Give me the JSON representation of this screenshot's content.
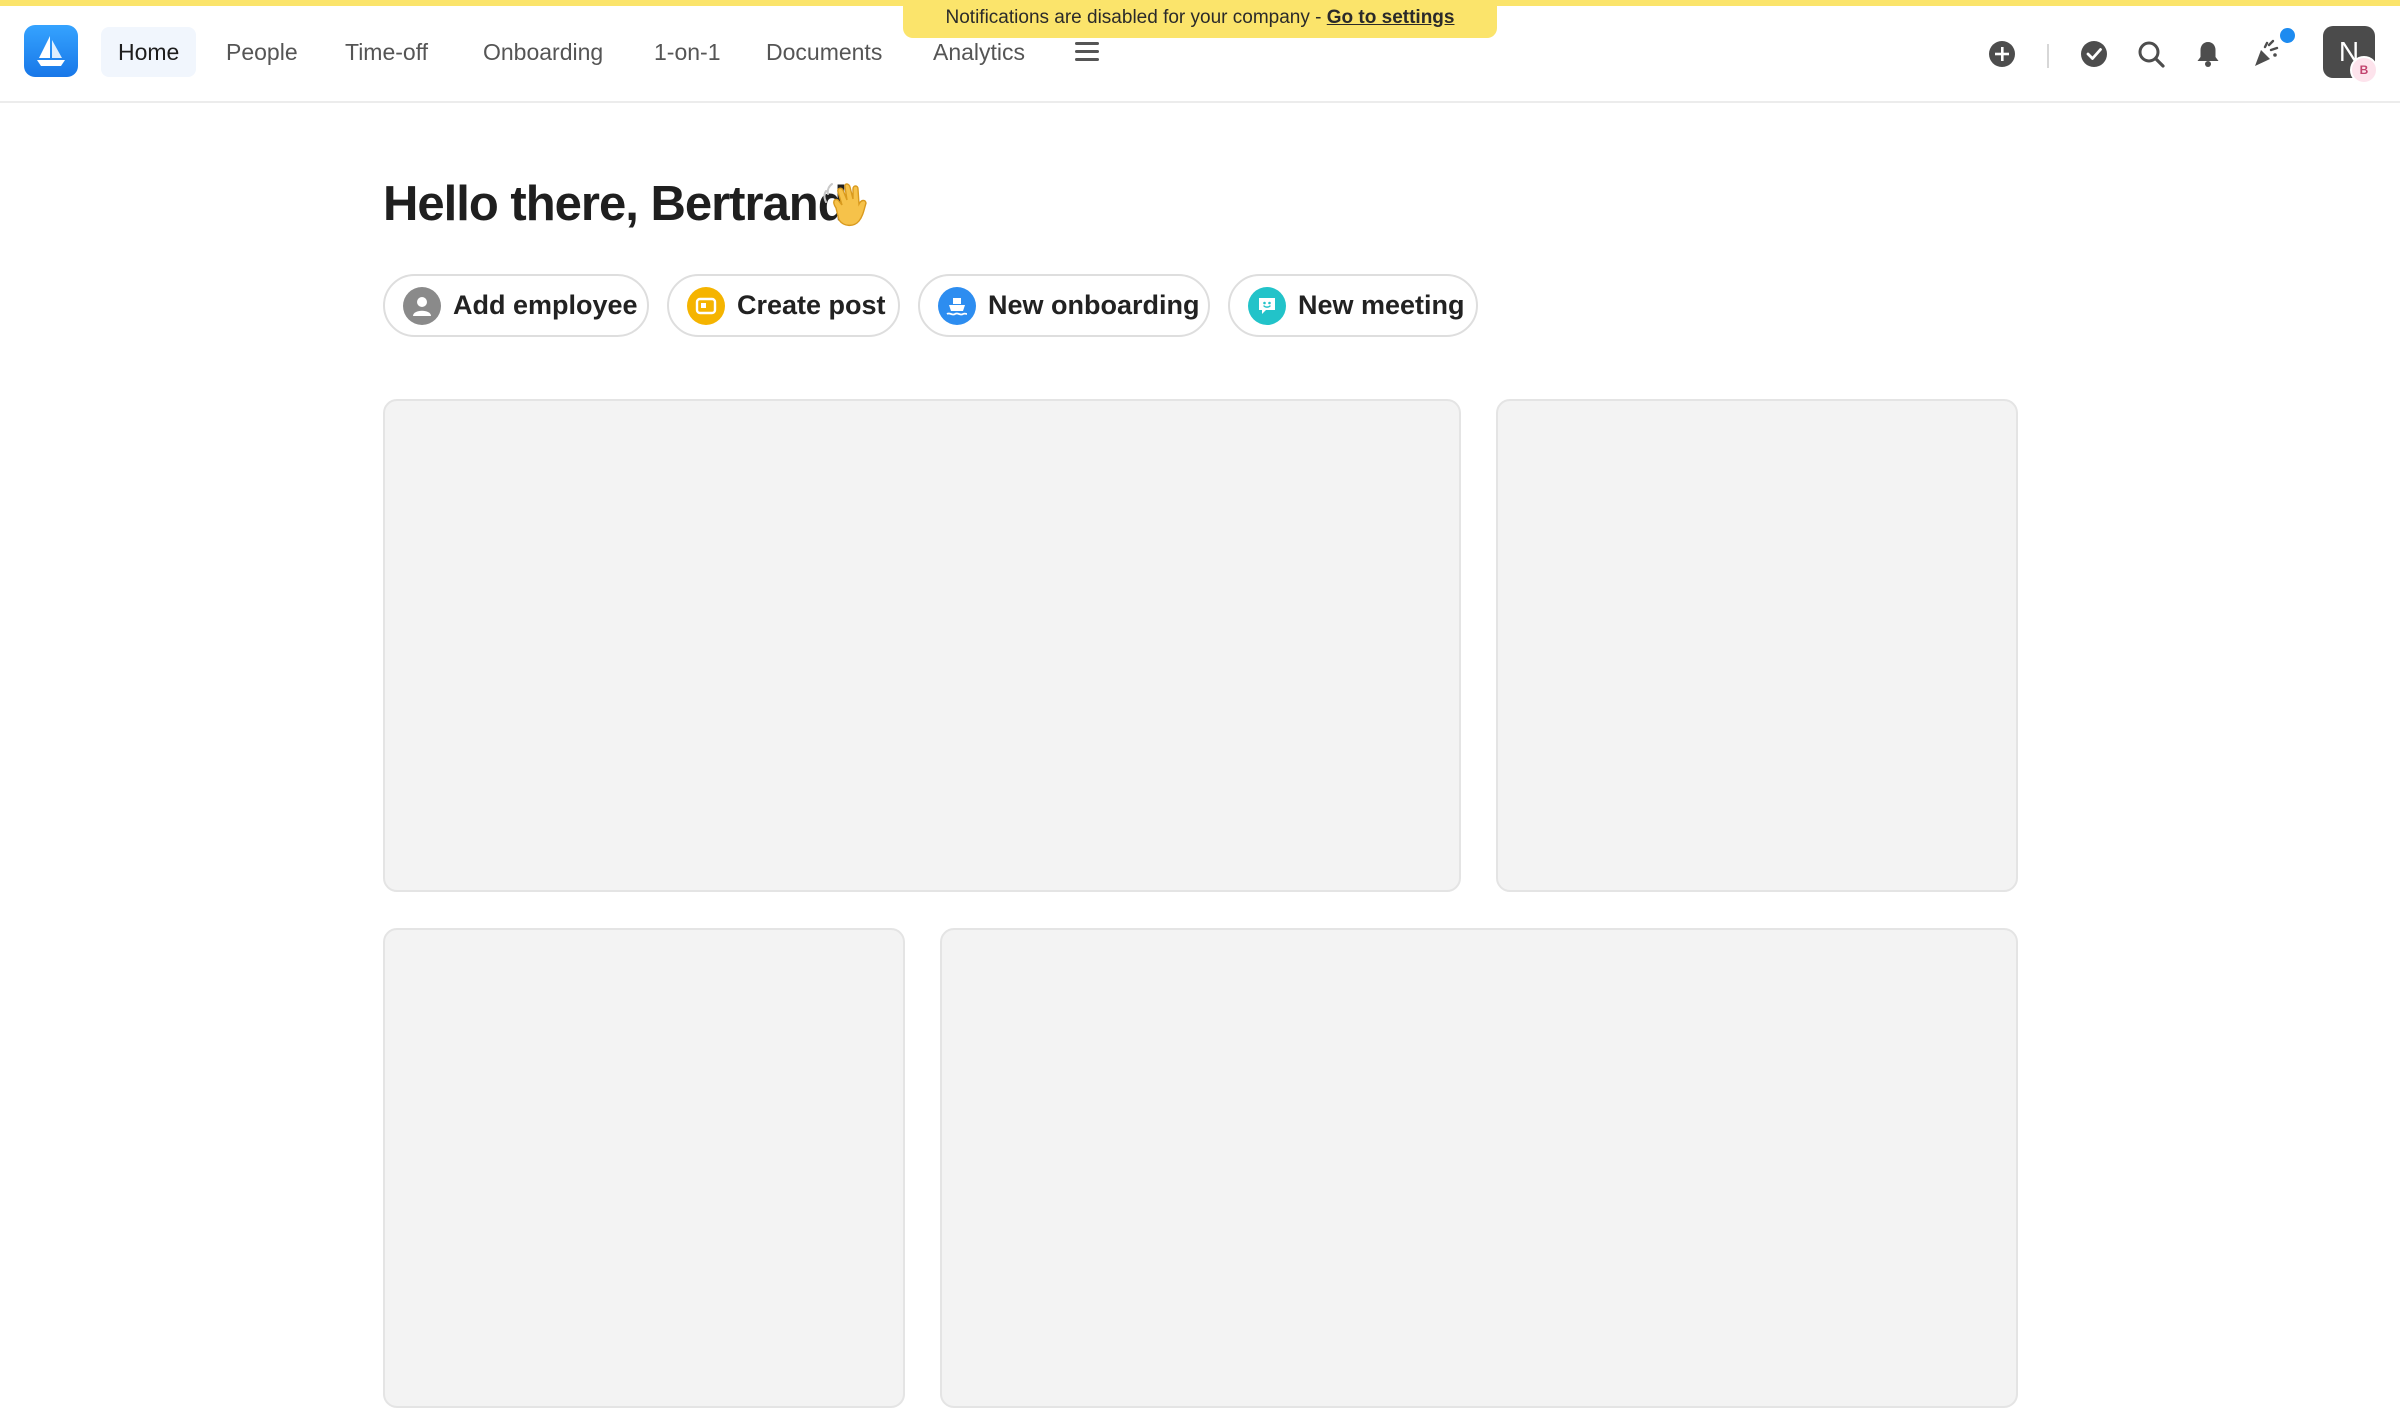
{
  "banner": {
    "text": "Notifications are disabled for your company - ",
    "link": "Go to settings"
  },
  "nav": {
    "items": [
      {
        "label": "Home",
        "active": true
      },
      {
        "label": "People",
        "active": false
      },
      {
        "label": "Time-off",
        "active": false
      },
      {
        "label": "Onboarding",
        "active": false
      },
      {
        "label": "1-on-1",
        "active": false
      },
      {
        "label": "Documents",
        "active": false
      },
      {
        "label": "Analytics",
        "active": false
      }
    ],
    "menu_icon": "hamburger-icon"
  },
  "toolbar": {
    "icons": [
      "plus-circle-icon",
      "check-circle-icon",
      "search-icon",
      "bell-icon",
      "party-popper-icon"
    ],
    "unread_indicator_color": "#1d8bf0"
  },
  "user": {
    "avatar_initial": "N",
    "badge_initial": "B"
  },
  "main": {
    "greeting": "Hello there, Bertrand",
    "greeting_emoji": "waving-hand-icon"
  },
  "actions": [
    {
      "label": "Add employee",
      "icon": "person-icon",
      "color": "#8a8a8a"
    },
    {
      "label": "Create post",
      "icon": "post-icon",
      "color": "#f5b400"
    },
    {
      "label": "New onboarding",
      "icon": "onboarding-boat-icon",
      "color": "#2d8df0"
    },
    {
      "label": "New meeting",
      "icon": "chat-face-icon",
      "color": "#22c3c9"
    }
  ],
  "colors": {
    "brand": "#1877e8",
    "banner": "#fbe46b",
    "placeholder_card": "#f3f3f3"
  }
}
